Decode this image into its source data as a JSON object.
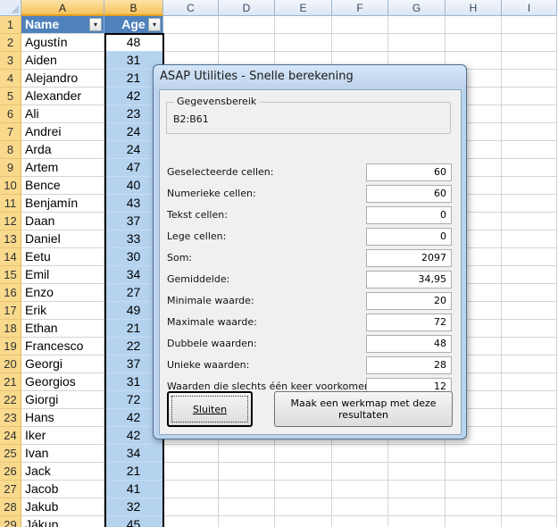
{
  "spreadsheet": {
    "columns": [
      "A",
      "B",
      "C",
      "D",
      "E",
      "F",
      "G",
      "H",
      "I"
    ],
    "header_row": {
      "row": "1",
      "name": "Name",
      "age": "Age"
    },
    "rows": [
      {
        "row": "2",
        "name": "Agustín",
        "age": "48"
      },
      {
        "row": "3",
        "name": "Aiden",
        "age": "31"
      },
      {
        "row": "4",
        "name": "Alejandro",
        "age": "21"
      },
      {
        "row": "5",
        "name": "Alexander",
        "age": "42"
      },
      {
        "row": "6",
        "name": "Ali",
        "age": "23"
      },
      {
        "row": "7",
        "name": "Andrei",
        "age": "24"
      },
      {
        "row": "8",
        "name": "Arda",
        "age": "24"
      },
      {
        "row": "9",
        "name": "Artem",
        "age": "47"
      },
      {
        "row": "10",
        "name": "Bence",
        "age": "40"
      },
      {
        "row": "11",
        "name": "Benjamín",
        "age": "43"
      },
      {
        "row": "12",
        "name": "Daan",
        "age": "37"
      },
      {
        "row": "13",
        "name": "Daniel",
        "age": "33"
      },
      {
        "row": "14",
        "name": "Eetu",
        "age": "30"
      },
      {
        "row": "15",
        "name": "Emil",
        "age": "34"
      },
      {
        "row": "16",
        "name": "Enzo",
        "age": "27"
      },
      {
        "row": "17",
        "name": "Erik",
        "age": "49"
      },
      {
        "row": "18",
        "name": "Ethan",
        "age": "21"
      },
      {
        "row": "19",
        "name": "Francesco",
        "age": "22"
      },
      {
        "row": "20",
        "name": "Georgi",
        "age": "37"
      },
      {
        "row": "21",
        "name": "Georgios",
        "age": "31"
      },
      {
        "row": "22",
        "name": "Giorgi",
        "age": "72"
      },
      {
        "row": "23",
        "name": "Hans",
        "age": "42"
      },
      {
        "row": "24",
        "name": "Iker",
        "age": "42"
      },
      {
        "row": "25",
        "name": "Ivan",
        "age": "34"
      },
      {
        "row": "26",
        "name": "Jack",
        "age": "21"
      },
      {
        "row": "27",
        "name": "Jacob",
        "age": "41"
      },
      {
        "row": "28",
        "name": "Jakub",
        "age": "32"
      },
      {
        "row": "29",
        "name": "Jákup",
        "age": "45"
      }
    ],
    "colors": {
      "header_fill": "#4f81bd",
      "selection_fill": "#b5d3ef",
      "row_header_selected": "#f9d98c"
    }
  },
  "dialog": {
    "title": "ASAP Utilities - Snelle berekening",
    "range_group_label": "Gegevensbereik",
    "range_value": "B2:B61",
    "stats": [
      {
        "label": "Geselecteerde cellen:",
        "value": "60"
      },
      {
        "label": "Numerieke cellen:",
        "value": "60"
      },
      {
        "label": "Tekst cellen:",
        "value": "0"
      },
      {
        "label": "Lege cellen:",
        "value": "0"
      },
      {
        "label": "Som:",
        "value": "2097"
      },
      {
        "label": "Gemiddelde:",
        "value": "34,95"
      },
      {
        "label": "Minimale waarde:",
        "value": "20"
      },
      {
        "label": "Maximale waarde:",
        "value": "72"
      },
      {
        "label": "Dubbele waarden:",
        "value": "48"
      },
      {
        "label": "Unieke waarden:",
        "value": "28"
      },
      {
        "label": "Waarden die slechts één keer voorkomen:",
        "value": "12"
      }
    ],
    "close_label": "Sluiten",
    "workbook_label": "Maak een werkmap met deze resultaten"
  }
}
